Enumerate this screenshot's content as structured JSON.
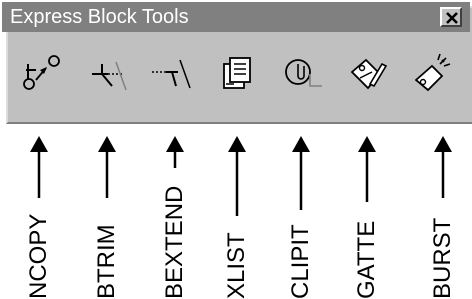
{
  "toolbar": {
    "title": "Express Block Tools",
    "close_glyph": "×",
    "tools": [
      {
        "command": "NCOPY",
        "icon": "ncopy-icon"
      },
      {
        "command": "BTRIM",
        "icon": "btrim-icon"
      },
      {
        "command": "BEXTEND",
        "icon": "bextend-icon"
      },
      {
        "command": "XLIST",
        "icon": "xlist-icon"
      },
      {
        "command": "CLIPIT",
        "icon": "clipit-icon"
      },
      {
        "command": "GATTE",
        "icon": "gatte-icon"
      },
      {
        "command": "BURST",
        "icon": "burst-icon"
      }
    ]
  },
  "labels": [
    "NCOPY",
    "BTRIM",
    "BEXTEND",
    "XLIST",
    "CLIPIT",
    "GATTE",
    "BURST"
  ],
  "colors": {
    "toolbar_face": "#c0c0c0",
    "title_bar": "#808080",
    "title_text": "#ffffff",
    "ink": "#000000"
  }
}
